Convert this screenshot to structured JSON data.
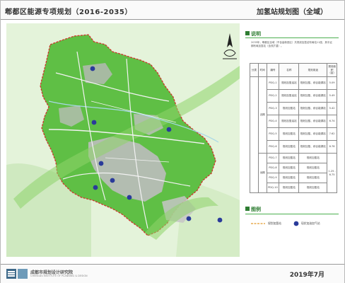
{
  "header": {
    "plan_title": "郫都区能源专项规划（2016-2035）",
    "map_title": "加氢站规划图（全域）"
  },
  "sidebar": {
    "description_heading": "说明",
    "description_text": "2035年，郫都区全域（不含高新西区）共规划加氢站布局站11座，其中近期布局加氢站（含改扩建）。",
    "table": {
      "headers": [
        "分类",
        "时间",
        "编号",
        "名称",
        "规划用途",
        "规划面积（亩）"
      ],
      "rows": [
        {
          "code": "PDQ-1",
          "name": "规划加氢油站",
          "use": "规划加氢、综合能源站",
          "area": "5.09"
        },
        {
          "code": "PDQ-2",
          "name": "规划加氢油站",
          "use": "规划加氢、综合能源站",
          "area": "5.49"
        },
        {
          "code": "PDQ-3",
          "name": "规划加氢站",
          "use": "规划加氢、综合能源站",
          "area": "5.42"
        },
        {
          "code": "PDQ-4",
          "name": "规划加氢油站",
          "use": "规划加氢、综合能源站",
          "area": "6.74"
        },
        {
          "code": "PDQ-5",
          "name": "规划加氢站",
          "use": "规划加氢、综合能源站",
          "area": "7.62"
        },
        {
          "code": "PDQ-6",
          "name": "规划加氢站",
          "use": "规划加氢、综合能源站",
          "area": "8.78"
        },
        {
          "code": "PDQ-7",
          "name": "规划加氢站",
          "use": "规划加氢站",
          "area": "1.25 - 6.75"
        },
        {
          "code": "PDQ-8",
          "name": "规划加氢站",
          "use": "规划加氢站",
          "area": ""
        },
        {
          "code": "PDQ-9",
          "name": "规划加氢站",
          "use": "规划加氢站",
          "area": ""
        },
        {
          "code": "PDQ-10",
          "name": "规划加氢站",
          "use": "规划加氢站",
          "area": ""
        }
      ],
      "group_labels": [
        "近期",
        "远期"
      ]
    },
    "legend_heading": "图例",
    "legend_items": [
      {
        "label": "规划加氢站"
      },
      {
        "label": "现状加油加气站"
      }
    ]
  },
  "footer": {
    "org_name": "成都市规划设计研究院",
    "org_en": "CHENGDU INSTITUTE OF PLANNING & DESIGN",
    "date": "2019年7月"
  },
  "colors": {
    "district_fill": "#5fbf45",
    "outside_fill": "#d9efcd",
    "belt_fill": "#8ed46a",
    "urban_fill": "#bdbdbd",
    "boundary": "#d0342c",
    "road": "#f2f2f2",
    "station_marker": "#2a3b9a",
    "accent_green": "#2e7d32"
  }
}
